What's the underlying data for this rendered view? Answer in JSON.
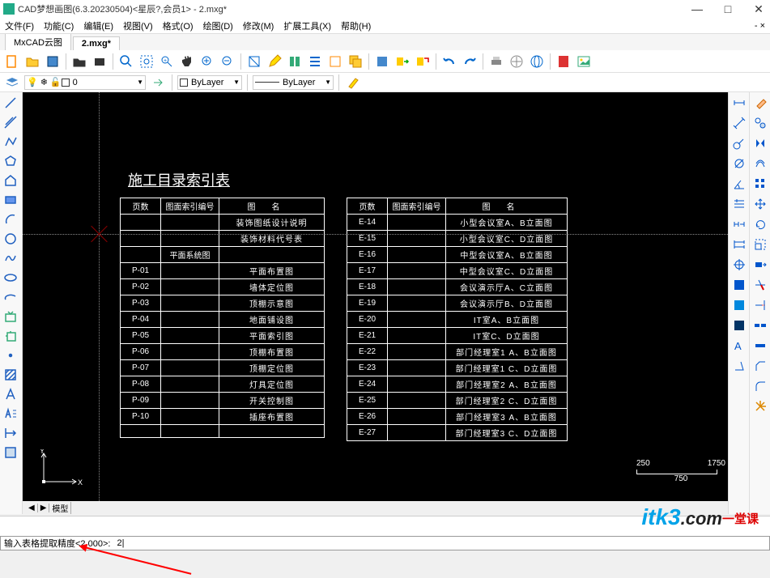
{
  "title": "CAD梦想画图(6.3.20230504)<星辰?,会员1> - 2.mxg*",
  "window_controls": {
    "min": "—",
    "max": "□",
    "close": "✕"
  },
  "menu": [
    "文件(F)",
    "功能(C)",
    "编辑(E)",
    "视图(V)",
    "格式(O)",
    "绘图(D)",
    "修改(M)",
    "扩展工具(X)",
    "帮助(H)"
  ],
  "filetabs": [
    {
      "label": "MxCAD云图",
      "active": false
    },
    {
      "label": "2.mxg*",
      "active": true
    }
  ],
  "layer": {
    "current": "0",
    "color": "ByLayer",
    "linetype": "ByLayer"
  },
  "drawing": {
    "title": "施工目录索引表",
    "table1_head": [
      "页数",
      "图面索引编号",
      "图名"
    ],
    "table1_rows": [
      [
        "",
        "",
        "装饰图纸设计说明"
      ],
      [
        "",
        "",
        "装饰材料代号表"
      ],
      [
        "",
        "平面系统图",
        ""
      ],
      [
        "P-01",
        "",
        "平面布置图"
      ],
      [
        "P-02",
        "",
        "墙体定位图"
      ],
      [
        "P-03",
        "",
        "顶棚示意图"
      ],
      [
        "P-04",
        "",
        "地面铺设图"
      ],
      [
        "P-05",
        "",
        "平面索引图"
      ],
      [
        "P-06",
        "",
        "顶棚布置图"
      ],
      [
        "P-07",
        "",
        "顶棚定位图"
      ],
      [
        "P-08",
        "",
        "灯具定位图"
      ],
      [
        "P-09",
        "",
        "开关控制图"
      ],
      [
        "P-10",
        "",
        "插座布置图"
      ],
      [
        "",
        "",
        ""
      ]
    ],
    "table2_head": [
      "页数",
      "图面索引编号",
      "图名"
    ],
    "table2_rows": [
      [
        "E-14",
        "",
        "小型会议室A、B立面图"
      ],
      [
        "E-15",
        "",
        "小型会议室C、D立面图"
      ],
      [
        "E-16",
        "",
        "中型会议室A、B立面图"
      ],
      [
        "E-17",
        "",
        "中型会议室C、D立面图"
      ],
      [
        "E-18",
        "",
        "会议演示厅A、C立面图"
      ],
      [
        "E-19",
        "",
        "会议演示厅B、D立面图"
      ],
      [
        "E-20",
        "",
        "IT室A、B立面图"
      ],
      [
        "E-21",
        "",
        "IT室C、D立面图"
      ],
      [
        "E-22",
        "",
        "部门经理室1 A、B立面图"
      ],
      [
        "E-23",
        "",
        "部门经理室1 C、D立面图"
      ],
      [
        "E-24",
        "",
        "部门经理室2 A、B立面图"
      ],
      [
        "E-25",
        "",
        "部门经理室2 C、D立面图"
      ],
      [
        "E-26",
        "",
        "部门经理室3 A、B立面图"
      ],
      [
        "E-27",
        "",
        "部门经理室3 C、D立面图"
      ]
    ],
    "scale": {
      "left": "250",
      "right": "1750",
      "mid": "750"
    }
  },
  "modeltabs": [
    "◀",
    "▶",
    "模型"
  ],
  "command": {
    "prompt": "输入表格提取精度<2.000>:",
    "value": "2"
  },
  "watermark": {
    "brand": "itk3",
    "dom": ".com",
    "tag": "一堂课"
  }
}
